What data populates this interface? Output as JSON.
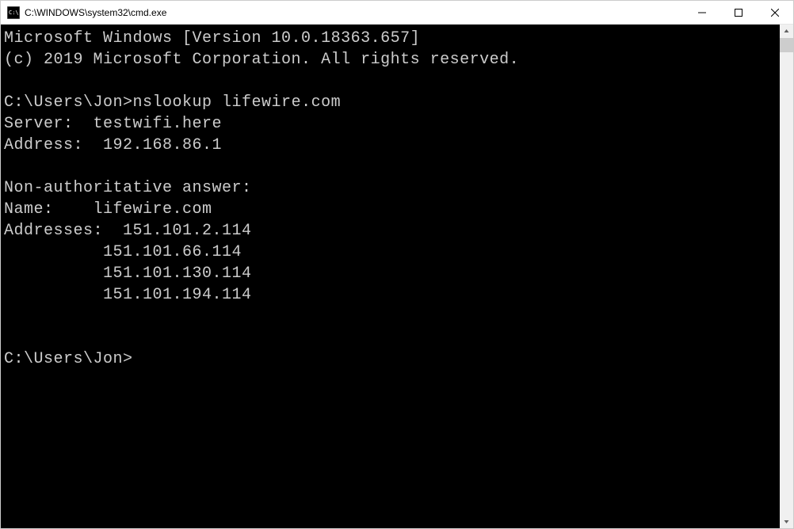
{
  "titlebar": {
    "path": "C:\\WINDOWS\\system32\\cmd.exe"
  },
  "terminal": {
    "banner_line1": "Microsoft Windows [Version 10.0.18363.657]",
    "banner_line2": "(c) 2019 Microsoft Corporation. All rights reserved.",
    "prompt1_path": "C:\\Users\\Jon>",
    "prompt1_command": "nslookup lifewire.com",
    "server_label": "Server:  ",
    "server_value": "testwifi.here",
    "address_label": "Address:  ",
    "address_value": "192.168.86.1",
    "nonauth_header": "Non-authoritative answer:",
    "name_label": "Name:    ",
    "name_value": "lifewire.com",
    "addresses_label": "Addresses:  ",
    "addresses": [
      "151.101.2.114",
      "151.101.66.114",
      "151.101.130.114",
      "151.101.194.114"
    ],
    "indent": "          ",
    "prompt2_path": "C:\\Users\\Jon>"
  }
}
